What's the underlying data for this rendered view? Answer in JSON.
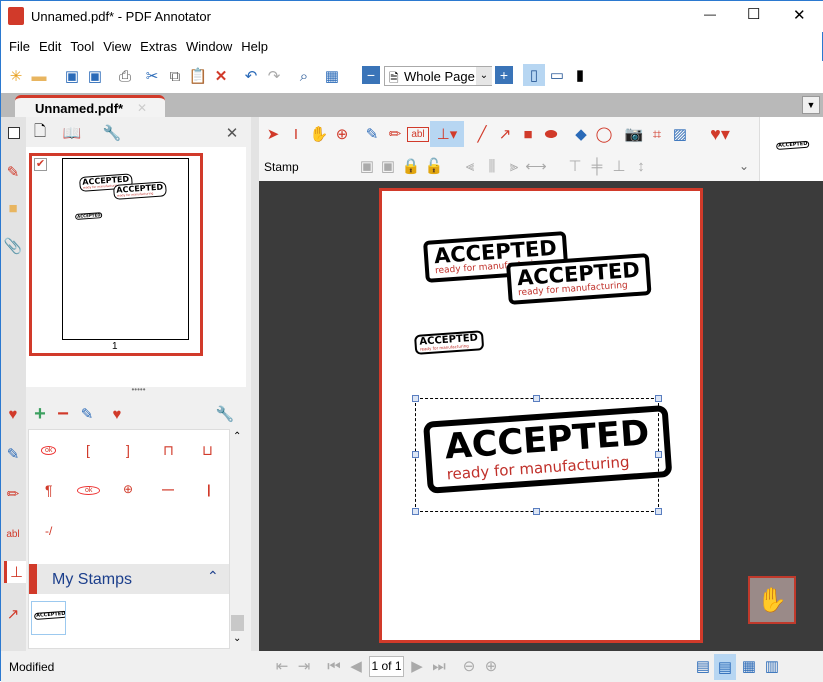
{
  "window": {
    "title": "Unnamed.pdf* - PDF Annotator",
    "minimize": "—",
    "maximize": "☐",
    "close": "✕"
  },
  "menu": [
    "File",
    "Edit",
    "Tool",
    "View",
    "Extras",
    "Window",
    "Help"
  ],
  "toolbar": {
    "zoom_value": "Whole Page"
  },
  "tabs": [
    {
      "label": "Unnamed.pdf*",
      "close": "✕"
    }
  ],
  "thumbnails": [
    {
      "page_label": "1"
    }
  ],
  "annotation_toolbar": {
    "mode_label": "Stamp"
  },
  "stamp": {
    "title": "ACCEPTED",
    "subtitle": "ready for manufacturing"
  },
  "stamp_panel": {
    "section_title": "My Stamps",
    "symbols": [
      "ok",
      "[",
      "]",
      "⊓",
      "⊔",
      "¶",
      "ok",
      "⊕",
      "—",
      "|",
      "-/"
    ]
  },
  "pagination": {
    "value": "1 of 1"
  },
  "status": {
    "text": "Modified"
  },
  "colors": {
    "accent": "#d13a2a",
    "doc_bg": "#3b3b3b",
    "selected": "#b7d6f2"
  }
}
